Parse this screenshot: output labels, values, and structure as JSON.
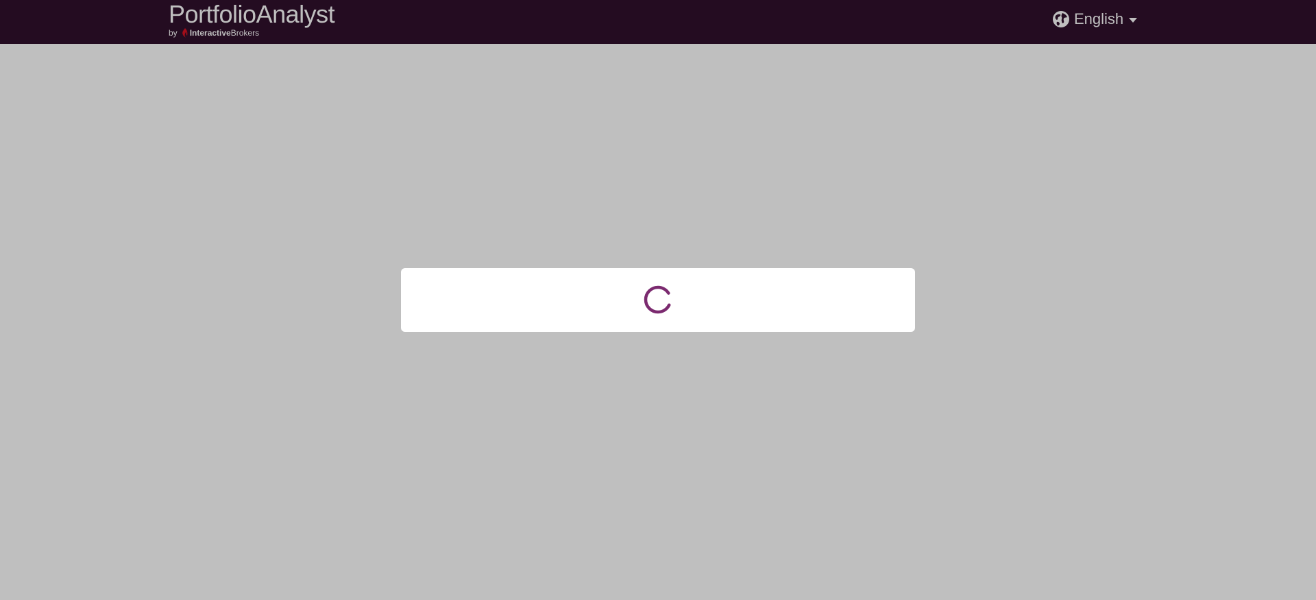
{
  "brand": {
    "title": "PortfolioAnalyst",
    "by": "by",
    "company_bold": "Interactive",
    "company_rest": "Brokers"
  },
  "language": {
    "selected": "English",
    "icon": "globe-icon",
    "dropdown_icon": "chevron-down-icon"
  },
  "loading": {
    "icon": "spinner-icon"
  },
  "colors": {
    "header_bg": "#30112d",
    "spinner": "#7b2a6f",
    "ib_red": "#d81222",
    "overlay": "rgba(0,0,0,0.25)"
  }
}
